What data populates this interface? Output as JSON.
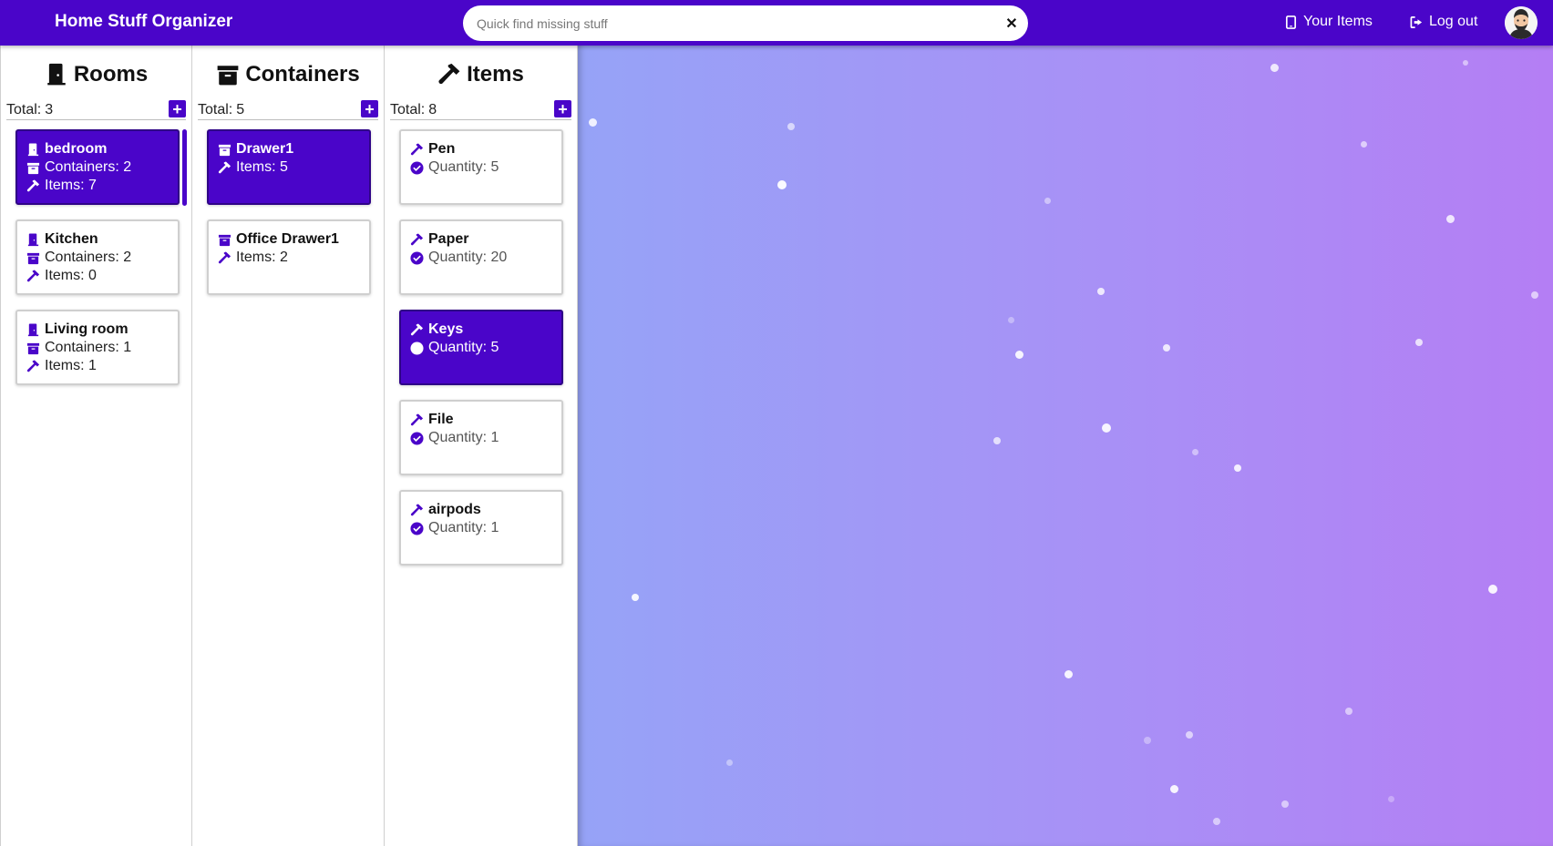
{
  "header": {
    "brand": "Home Stuff Organizer",
    "search_placeholder": "Quick find missing stuff",
    "clear_symbol": "✕",
    "your_items_label": "Your Items",
    "logout_label": "Log out",
    "accent_color": "#4a05c9"
  },
  "rooms": {
    "heading": "Rooms",
    "total_label": "Total:",
    "total": "3",
    "cards": [
      {
        "name": "bedroom",
        "containers": "Containers: 2",
        "items": "Items: 7",
        "selected": true
      },
      {
        "name": "Kitchen",
        "containers": "Containers: 2",
        "items": "Items: 0",
        "selected": false
      },
      {
        "name": "Living room",
        "containers": "Containers: 1",
        "items": "Items: 1",
        "selected": false
      }
    ]
  },
  "containers": {
    "heading": "Containers",
    "total_label": "Total:",
    "total": "5",
    "cards": [
      {
        "name": "Drawer1",
        "items": "Items: 5",
        "selected": true
      },
      {
        "name": "Office Drawer1",
        "items": "Items: 2",
        "selected": false
      }
    ]
  },
  "items": {
    "heading": "Items",
    "total_label": "Total:",
    "total": "8",
    "cards": [
      {
        "name": "Pen",
        "quantity": "Quantity: 5",
        "selected": false
      },
      {
        "name": "Paper",
        "quantity": "Quantity: 20",
        "selected": false
      },
      {
        "name": "Keys",
        "quantity": "Quantity: 5",
        "selected": true
      },
      {
        "name": "File",
        "quantity": "Quantity: 1",
        "selected": false
      },
      {
        "name": "airpods",
        "quantity": "Quantity: 1",
        "selected": false
      }
    ]
  },
  "icons": {
    "room": "door-icon",
    "container": "archive-box-icon",
    "item": "hammer-icon",
    "quantity": "check-circle-icon",
    "your_items": "tablet-icon",
    "logout": "logout-icon"
  }
}
